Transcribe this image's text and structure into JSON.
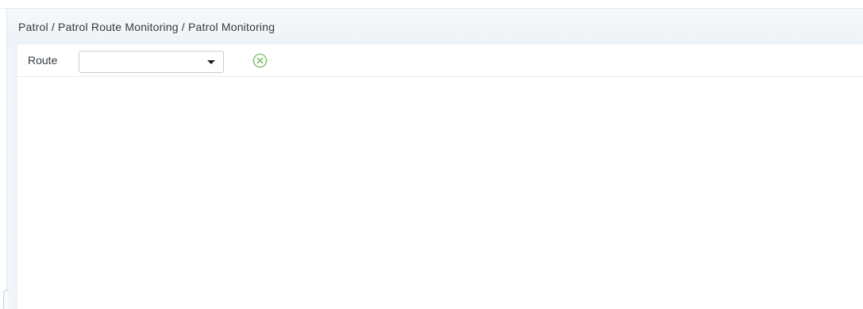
{
  "breadcrumb": {
    "text": "Patrol / Patrol Route Monitoring / Patrol Monitoring"
  },
  "filter": {
    "route_label": "Route",
    "route_value": "",
    "clear_icon": "clear-circle-icon"
  },
  "colors": {
    "accent": "#7dbf6c",
    "border": "#c7cfd6"
  }
}
